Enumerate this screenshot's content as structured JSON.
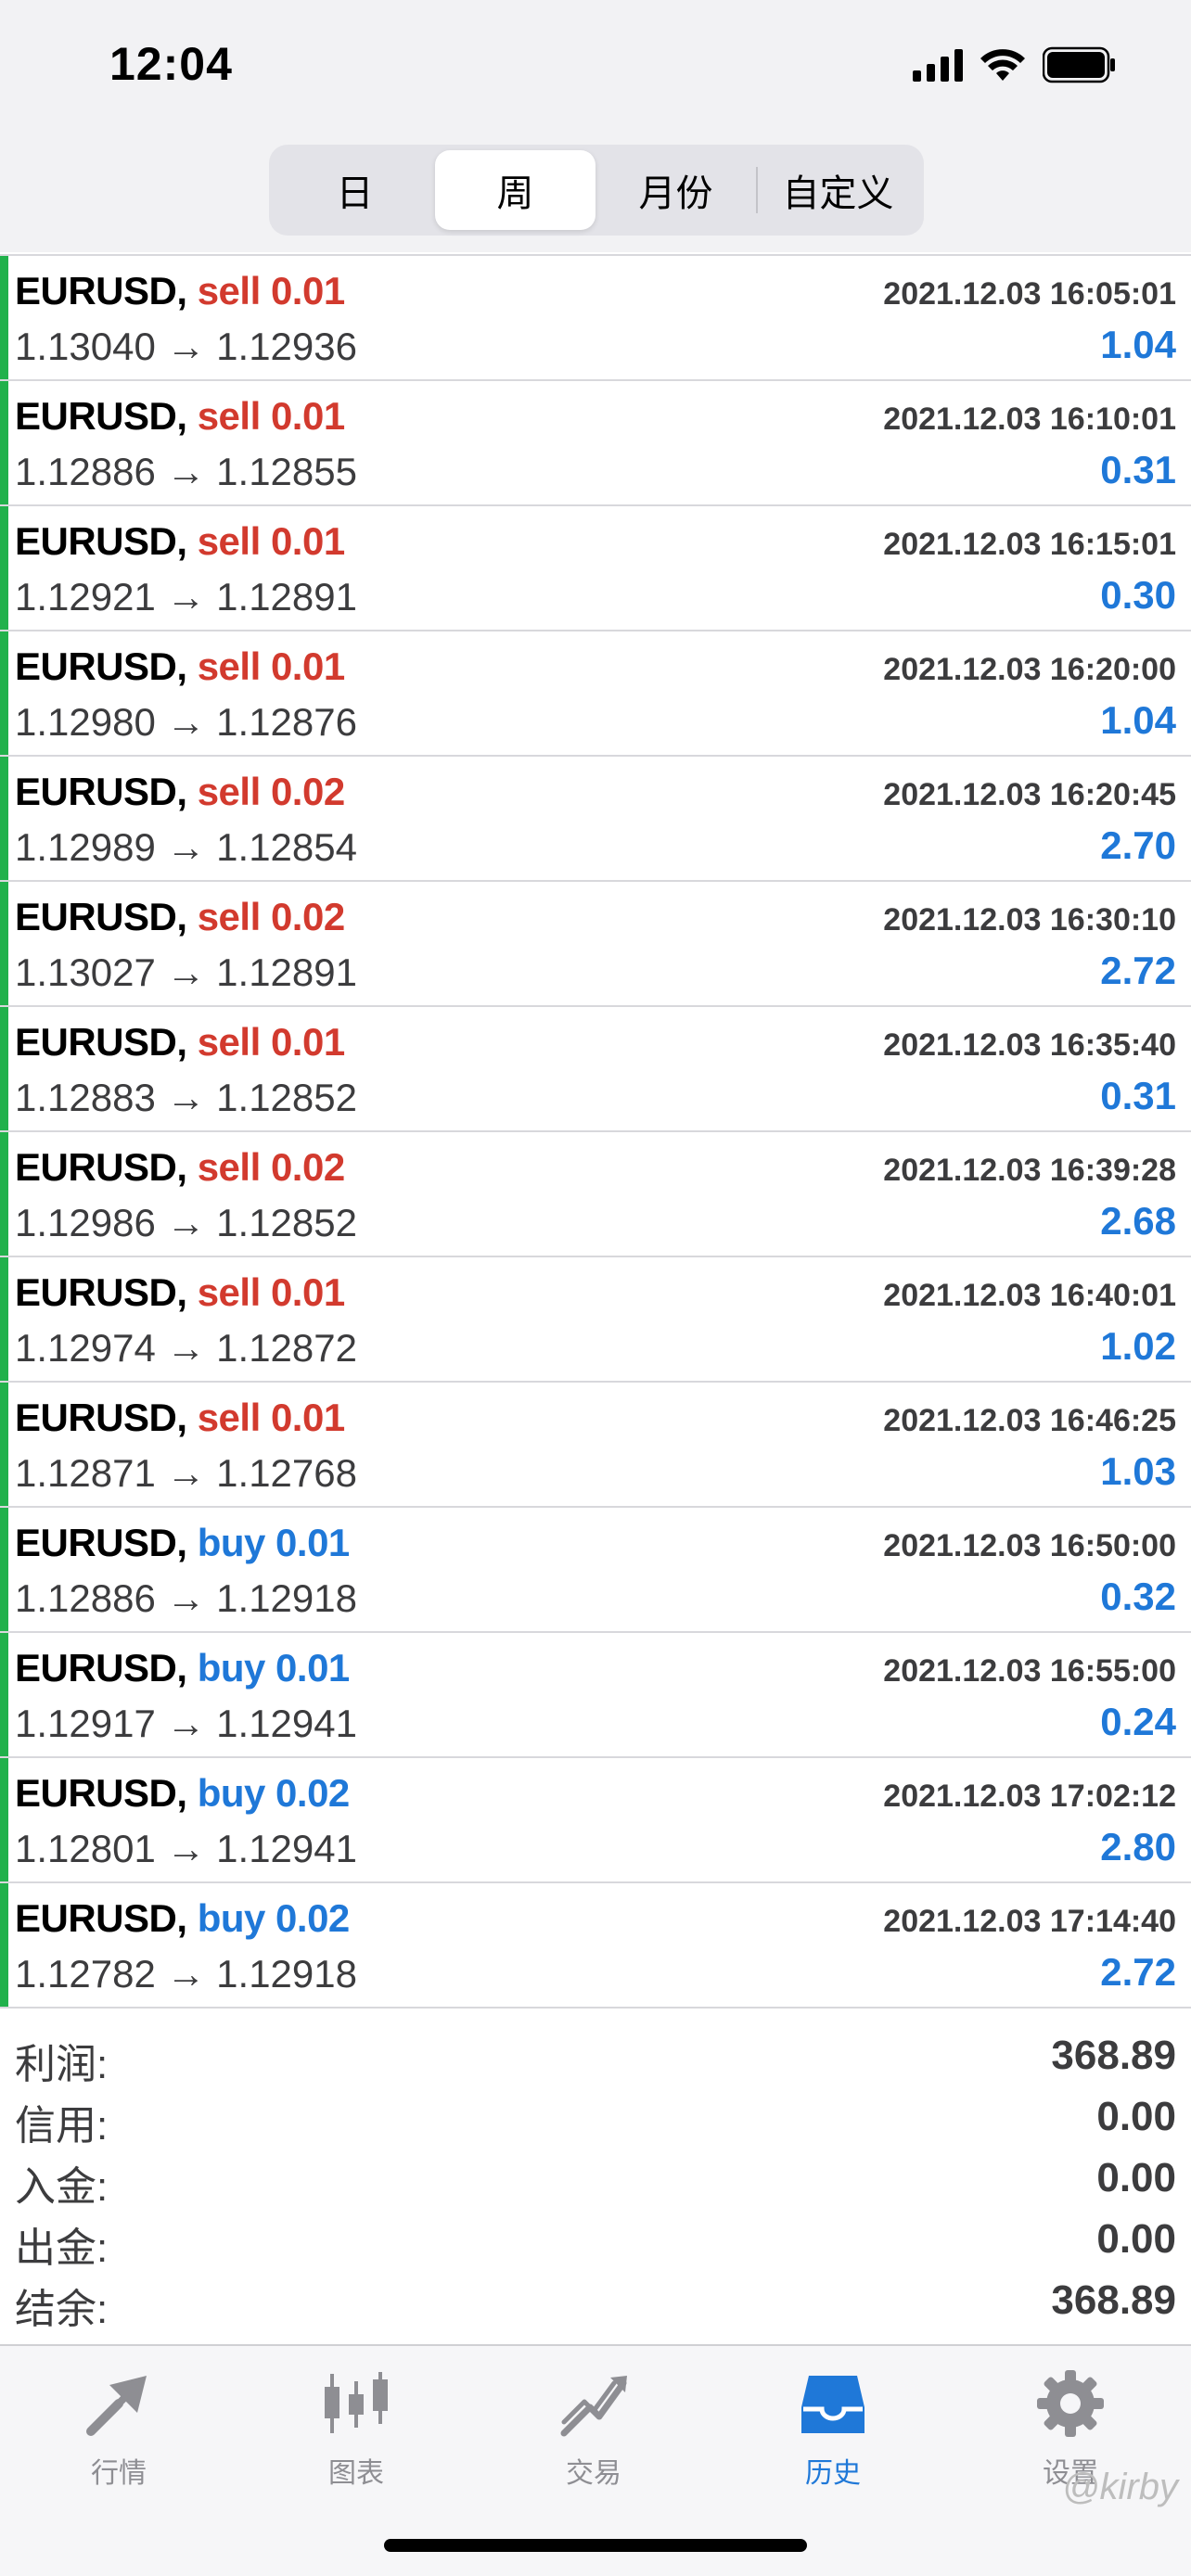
{
  "status_bar": {
    "time": "12:04"
  },
  "segment": {
    "items": [
      {
        "label": "日",
        "active": false
      },
      {
        "label": "周",
        "active": true
      },
      {
        "label": "月份",
        "active": false
      },
      {
        "label": "自定义",
        "active": false
      }
    ]
  },
  "trades": [
    {
      "symbol": "EURUSD,",
      "side": "sell",
      "volume": "0.01",
      "time": "2021.12.03 16:05:01",
      "open": "1.13040",
      "close": "1.12936",
      "profit": "1.04"
    },
    {
      "symbol": "EURUSD,",
      "side": "sell",
      "volume": "0.01",
      "time": "2021.12.03 16:10:01",
      "open": "1.12886",
      "close": "1.12855",
      "profit": "0.31"
    },
    {
      "symbol": "EURUSD,",
      "side": "sell",
      "volume": "0.01",
      "time": "2021.12.03 16:15:01",
      "open": "1.12921",
      "close": "1.12891",
      "profit": "0.30"
    },
    {
      "symbol": "EURUSD,",
      "side": "sell",
      "volume": "0.01",
      "time": "2021.12.03 16:20:00",
      "open": "1.12980",
      "close": "1.12876",
      "profit": "1.04"
    },
    {
      "symbol": "EURUSD,",
      "side": "sell",
      "volume": "0.02",
      "time": "2021.12.03 16:20:45",
      "open": "1.12989",
      "close": "1.12854",
      "profit": "2.70"
    },
    {
      "symbol": "EURUSD,",
      "side": "sell",
      "volume": "0.02",
      "time": "2021.12.03 16:30:10",
      "open": "1.13027",
      "close": "1.12891",
      "profit": "2.72"
    },
    {
      "symbol": "EURUSD,",
      "side": "sell",
      "volume": "0.01",
      "time": "2021.12.03 16:35:40",
      "open": "1.12883",
      "close": "1.12852",
      "profit": "0.31"
    },
    {
      "symbol": "EURUSD,",
      "side": "sell",
      "volume": "0.02",
      "time": "2021.12.03 16:39:28",
      "open": "1.12986",
      "close": "1.12852",
      "profit": "2.68"
    },
    {
      "symbol": "EURUSD,",
      "side": "sell",
      "volume": "0.01",
      "time": "2021.12.03 16:40:01",
      "open": "1.12974",
      "close": "1.12872",
      "profit": "1.02"
    },
    {
      "symbol": "EURUSD,",
      "side": "sell",
      "volume": "0.01",
      "time": "2021.12.03 16:46:25",
      "open": "1.12871",
      "close": "1.12768",
      "profit": "1.03"
    },
    {
      "symbol": "EURUSD,",
      "side": "buy",
      "volume": "0.01",
      "time": "2021.12.03 16:50:00",
      "open": "1.12886",
      "close": "1.12918",
      "profit": "0.32"
    },
    {
      "symbol": "EURUSD,",
      "side": "buy",
      "volume": "0.01",
      "time": "2021.12.03 16:55:00",
      "open": "1.12917",
      "close": "1.12941",
      "profit": "0.24"
    },
    {
      "symbol": "EURUSD,",
      "side": "buy",
      "volume": "0.02",
      "time": "2021.12.03 17:02:12",
      "open": "1.12801",
      "close": "1.12941",
      "profit": "2.80"
    },
    {
      "symbol": "EURUSD,",
      "side": "buy",
      "volume": "0.02",
      "time": "2021.12.03 17:14:40",
      "open": "1.12782",
      "close": "1.12918",
      "profit": "2.72"
    }
  ],
  "arrow": "→",
  "summary": [
    {
      "label": "利润:",
      "value": "368.89"
    },
    {
      "label": "信用:",
      "value": "0.00"
    },
    {
      "label": "入金:",
      "value": "0.00"
    },
    {
      "label": "出金:",
      "value": "0.00"
    },
    {
      "label": "结余:",
      "value": "368.89"
    }
  ],
  "tabs": [
    {
      "label": "行情",
      "icon": "quotes-icon",
      "active": false
    },
    {
      "label": "图表",
      "icon": "chart-icon",
      "active": false
    },
    {
      "label": "交易",
      "icon": "trade-icon",
      "active": false
    },
    {
      "label": "历史",
      "icon": "history-icon",
      "active": true
    },
    {
      "label": "设置",
      "icon": "settings-icon",
      "active": false
    }
  ],
  "watermark": "@kirby",
  "colors": {
    "sell": "#d23a2e",
    "buy": "#1f78d8",
    "profit": "#1f78d8",
    "row_bar": "#21b14b",
    "tab_active": "#1f78d8",
    "tab_inactive": "#8e8e93"
  }
}
